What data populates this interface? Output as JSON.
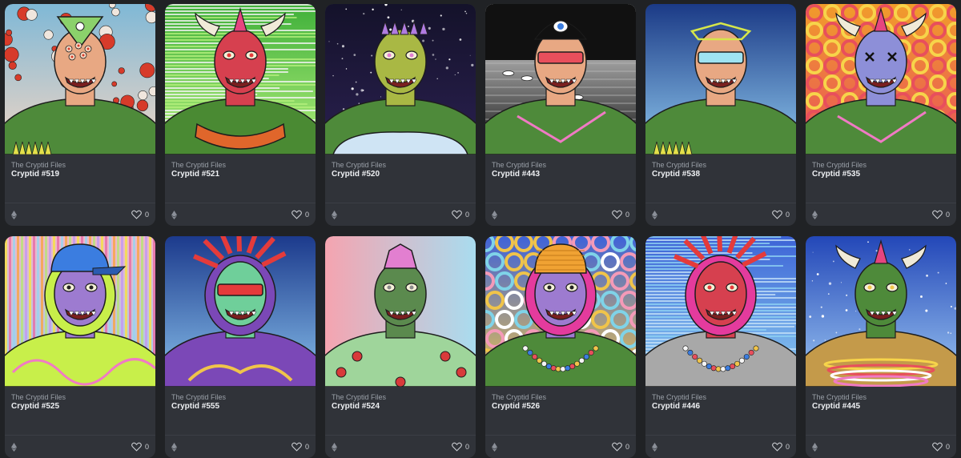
{
  "cards": [
    {
      "collection": "The Cryptid Files",
      "title": "Cryptid #519",
      "likes": "0",
      "art": {
        "bg": "#7fb8d6",
        "bg2": "#f2d6c4",
        "pattern": "dots",
        "dotColor": "#d73b2a",
        "skin": "#e8a883",
        "body": "#4e8a3a",
        "top": "tri",
        "topColor": "#8bd16b",
        "eyes": "multi",
        "feat": "spikes"
      }
    },
    {
      "collection": "The Cryptid Files",
      "title": "Cryptid #521",
      "likes": "0",
      "art": {
        "bg": "#3fb03a",
        "bg2": "#b4ef7c",
        "pattern": "hstripes",
        "dotColor": "#f4f4f4",
        "skin": "#d6404f",
        "body": "#4a8a33",
        "top": "horns",
        "topColor": "#e6457f",
        "eyes": "red",
        "feat": "collar"
      }
    },
    {
      "collection": "The Cryptid Files",
      "title": "Cryptid #520",
      "likes": "0",
      "art": {
        "bg": "#14122a",
        "bg2": "#2a2050",
        "pattern": "stars",
        "dotColor": "#ffffff",
        "skin": "#a9b844",
        "body": "#4e8a3a",
        "top": "spikes",
        "topColor": "#b07be0",
        "eyes": "pink",
        "feat": "shirt"
      }
    },
    {
      "collection": "The Cryptid Files",
      "title": "Cryptid #443",
      "likes": "0",
      "art": {
        "bg": "#f4f4f4",
        "bg2": "#111111",
        "pattern": "bw",
        "dotColor": "#cfcfcf",
        "skin": "#e8a883",
        "body": "#4e8a3a",
        "top": "cyclops",
        "topColor": "#111111",
        "eyes": "visor",
        "feat": "pink"
      }
    },
    {
      "collection": "The Cryptid Files",
      "title": "Cryptid #538",
      "likes": "0",
      "art": {
        "bg": "#1b3a86",
        "bg2": "#8fc8ee",
        "pattern": "gradient",
        "dotColor": "#ffffff",
        "skin": "#e8a883",
        "body": "#4e8a3a",
        "top": "halo",
        "topColor": "#d6e64a",
        "eyes": "shades",
        "feat": "spikes"
      }
    },
    {
      "collection": "The Cryptid Files",
      "title": "Cryptid #535",
      "likes": "0",
      "art": {
        "bg": "#f19c2b",
        "bg2": "#e84f5c",
        "pattern": "waves",
        "dotColor": "#f7d44a",
        "skin": "#8d8fd8",
        "body": "#4e8a3a",
        "top": "horns",
        "topColor": "#e6457f",
        "eyes": "xx",
        "feat": "pink"
      }
    },
    {
      "collection": "The Cryptid Files",
      "title": "Cryptid #525",
      "likes": "0",
      "art": {
        "bg": "#f1b7c9",
        "bg2": "#9ad2ef",
        "pattern": "vstripes",
        "dotColor": "#f4e04a",
        "skin": "#9d7bd0",
        "body": "#c8ef4a",
        "top": "cap",
        "topColor": "#3b7de0",
        "eyes": "dots",
        "feat": "swirl"
      }
    },
    {
      "collection": "The Cryptid Files",
      "title": "Cryptid #555",
      "likes": "0",
      "art": {
        "bg": "#1c3a8c",
        "bg2": "#89c1ec",
        "pattern": "gradient",
        "dotColor": "#ffffff",
        "skin": "#6fcf9a",
        "body": "#7b48b7",
        "top": "rays",
        "topColor": "#e43b3b",
        "eyes": "redshades",
        "feat": "mane"
      }
    },
    {
      "collection": "The Cryptid Files",
      "title": "Cryptid #524",
      "likes": "0",
      "art": {
        "bg": "#f5a4b0",
        "bg2": "#a9dcef",
        "pattern": "hgradient",
        "dotColor": "#ffffff",
        "skin": "#5b8a4e",
        "body": "#9fd59b",
        "top": "crystal",
        "topColor": "#e27fd0",
        "eyes": "grey",
        "feat": "balls"
      }
    },
    {
      "collection": "The Cryptid Files",
      "title": "Cryptid #526",
      "likes": "0",
      "art": {
        "bg": "#3f63d8",
        "bg2": "#f0c44a",
        "pattern": "rings",
        "dotColor": "#f49ab8",
        "skin": "#9d7bd0",
        "body": "#4e8a3a",
        "top": "beanie",
        "topColor": "#f0a233",
        "eyes": "dots",
        "feat": "beads"
      }
    },
    {
      "collection": "The Cryptid Files",
      "title": "Cryptid #446",
      "likes": "0",
      "art": {
        "bg": "#3c63d6",
        "bg2": "#8fd1f2",
        "pattern": "hstripes",
        "dotColor": "#c3e0f7",
        "skin": "#d6404f",
        "body": "#a8a8a8",
        "top": "rays",
        "topColor": "#e43b3b",
        "eyes": "red",
        "feat": "beads"
      }
    },
    {
      "collection": "The Cryptid Files",
      "title": "Cryptid #445",
      "likes": "0",
      "art": {
        "bg": "#2347b8",
        "bg2": "#9cc7f2",
        "pattern": "stars",
        "dotColor": "#ffffff",
        "skin": "#4e8a3a",
        "body": "#c49a4a",
        "top": "horns",
        "topColor": "#e6457f",
        "eyes": "yellow",
        "feat": "rings"
      }
    }
  ]
}
